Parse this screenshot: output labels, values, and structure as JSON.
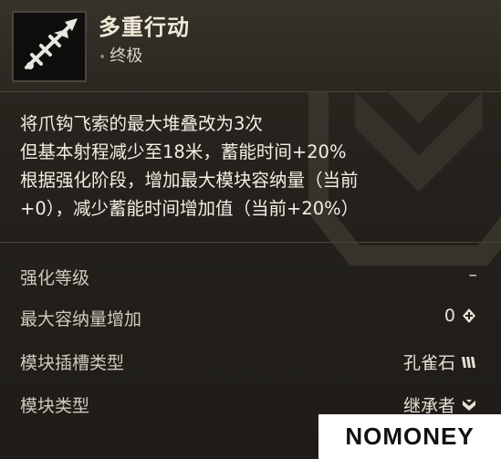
{
  "header": {
    "title": "多重行动",
    "rarity": "终极",
    "icon": "chain-hook-icon"
  },
  "description": {
    "lines": [
      "将爪钩飞索的最大堆叠改为3次",
      "但基本射程减少至18米，蓄能时间+20%",
      "根据强化阶段，增加最大模块容纳量（当前",
      "+0），减少蓄能时间增加值（当前+20%）"
    ]
  },
  "stats": [
    {
      "label": "强化等级",
      "value": "–",
      "icon": ""
    },
    {
      "label": "最大容纳量增加",
      "value": "0",
      "icon": "capacity-icon"
    },
    {
      "label": "模块插槽类型",
      "value": "孔雀石",
      "icon": "malachite-slot-icon"
    },
    {
      "label": "模块类型",
      "value": "继承者",
      "icon": "successor-type-icon"
    }
  ],
  "watermark": {
    "text": "NOMONEY"
  },
  "colors": {
    "background": "#24211c",
    "header": "#37322a",
    "text": "#f2eee4",
    "label": "#cfc9bd"
  }
}
